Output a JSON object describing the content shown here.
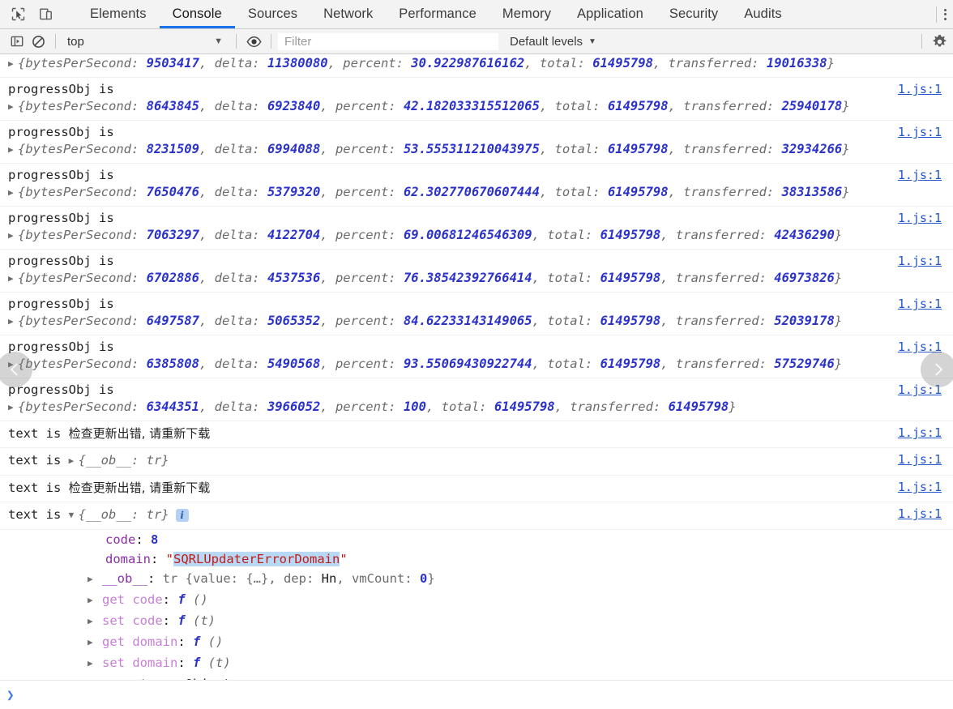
{
  "tabbar": {
    "icons": [
      {
        "name": "inspect-element-icon"
      },
      {
        "name": "device-toolbar-icon"
      }
    ],
    "tabs": [
      {
        "label": "Elements",
        "active": false
      },
      {
        "label": "Console",
        "active": true
      },
      {
        "label": "Sources",
        "active": false
      },
      {
        "label": "Network",
        "active": false
      },
      {
        "label": "Performance",
        "active": false
      },
      {
        "label": "Memory",
        "active": false
      },
      {
        "label": "Application",
        "active": false
      },
      {
        "label": "Security",
        "active": false
      },
      {
        "label": "Audits",
        "active": false
      }
    ],
    "more_label": "more-tabs"
  },
  "filterbar": {
    "sidebar_toggle": "show-console-sidebar-icon",
    "clear_label": "clear-console-icon",
    "context": "top",
    "context_caret": "▼",
    "eye_icon": "live-expression-eye-icon",
    "filter_placeholder": "Filter",
    "filter_value": "",
    "levels_label": "Default levels",
    "levels_caret": "▼",
    "settings_icon": "gear-icon"
  },
  "console": {
    "partial_top_row": {
      "text_prefix": "progressObj is",
      "source": "1.js:1",
      "detail_prefix": "{bytesPerSecond: ",
      "bytesPerSecond": "9503417",
      "delta_label": ", delta: ",
      "delta": "11380080",
      "percent_label": ", percent: ",
      "percent": "30.922987616162",
      "total_label": ", total: ",
      "total": "61495798",
      "transferred_label": ", transferred: ",
      "transferred": "19016338",
      "close": "}"
    },
    "label": "progressObj is",
    "text_label": "text is",
    "source": "1.js:1",
    "progress_entries": [
      {
        "bytesPerSecond": "9503417",
        "delta": "11380080",
        "percent": "30.922987616162",
        "total": "61495798",
        "transferred": "19016338"
      },
      {
        "bytesPerSecond": "8643845",
        "delta": "6923840",
        "percent": "42.182033315512065",
        "total": "61495798",
        "transferred": "25940178"
      },
      {
        "bytesPerSecond": "8231509",
        "delta": "6994088",
        "percent": "53.555311210043975",
        "total": "61495798",
        "transferred": "32934266"
      },
      {
        "bytesPerSecond": "7650476",
        "delta": "5379320",
        "percent": "62.302770670607444",
        "total": "61495798",
        "transferred": "38313586"
      },
      {
        "bytesPerSecond": "7063297",
        "delta": "4122704",
        "percent": "69.00681246546309",
        "total": "61495798",
        "transferred": "42436290"
      },
      {
        "bytesPerSecond": "6702886",
        "delta": "4537536",
        "percent": "76.38542392766414",
        "total": "61495798",
        "transferred": "46973826"
      },
      {
        "bytesPerSecond": "6497587",
        "delta": "5065352",
        "percent": "84.62233143149065",
        "total": "61495798",
        "transferred": "52039178"
      },
      {
        "bytesPerSecond": "6385808",
        "delta": "5490568",
        "percent": "93.55069430922744",
        "total": "61495798",
        "transferred": "57529746"
      },
      {
        "bytesPerSecond": "6344351",
        "delta": "3966052",
        "percent": "100",
        "total": "61495798",
        "transferred": "61495798"
      }
    ],
    "obj_tokens": {
      "open": "{bytesPerSecond: ",
      "delta": ", delta: ",
      "percent": ", percent: ",
      "total": ", total: ",
      "transferred": ", transferred: ",
      "close": "}"
    },
    "text_entries": [
      {
        "kind": "string",
        "value": "检查更新出错, 请重新下载",
        "source": "1.js:1"
      },
      {
        "kind": "object",
        "collapsed": true,
        "preview": "{__ob__: tr}",
        "source": "1.js:1"
      },
      {
        "kind": "string",
        "value": "检查更新出错, 请重新下载",
        "source": "1.js:1"
      },
      {
        "kind": "object",
        "collapsed": false,
        "preview": "{__ob__: tr}",
        "badge": "i",
        "source": "1.js:1"
      }
    ],
    "expanded_tree": [
      {
        "indent": 0,
        "arrow": false,
        "key": "code",
        "key_style": "own",
        "sep": ": ",
        "value": "8",
        "value_style": "number"
      },
      {
        "indent": 0,
        "arrow": false,
        "key": "domain",
        "key_style": "own",
        "sep": ": ",
        "value": "\"SQRLUpdaterErrorDomain\"",
        "value_style": "string-selected",
        "string_inner": "SQRLUpdaterErrorDomain"
      },
      {
        "indent": 0,
        "arrow": true,
        "key": "__ob__",
        "key_style": "own",
        "sep": ": ",
        "value": "tr {value: {…}, dep: Hn, vmCount: 0}",
        "value_style": "object-preview"
      },
      {
        "indent": 0,
        "arrow": true,
        "key": "get code",
        "key_style": "accessor",
        "sep": ": ",
        "value": "f ()",
        "value_style": "function"
      },
      {
        "indent": 0,
        "arrow": true,
        "key": "set code",
        "key_style": "accessor",
        "sep": ": ",
        "value": "f (t)",
        "value_style": "function"
      },
      {
        "indent": 0,
        "arrow": true,
        "key": "get domain",
        "key_style": "accessor",
        "sep": ": ",
        "value": "f ()",
        "value_style": "function"
      },
      {
        "indent": 0,
        "arrow": true,
        "key": "set domain",
        "key_style": "accessor",
        "sep": ": ",
        "value": "f (t)",
        "value_style": "function"
      },
      {
        "indent": 0,
        "arrow": true,
        "key": "__proto__",
        "key_style": "own-underline",
        "sep": ": ",
        "value": "Object",
        "value_style": "plain"
      }
    ],
    "prompt_chevron": "❯"
  },
  "overlays": {
    "prev_label": "previous-screenshot-arrow",
    "next_label": "next-screenshot-arrow"
  },
  "colors": {
    "accent": "#1a73e8",
    "link": "#2255cc",
    "number": "#2b32c8",
    "string": "#c41a16",
    "accessor": "#c77fd6",
    "own_key": "#8b2fa8",
    "toolbar_bg": "#f3f3f3"
  }
}
